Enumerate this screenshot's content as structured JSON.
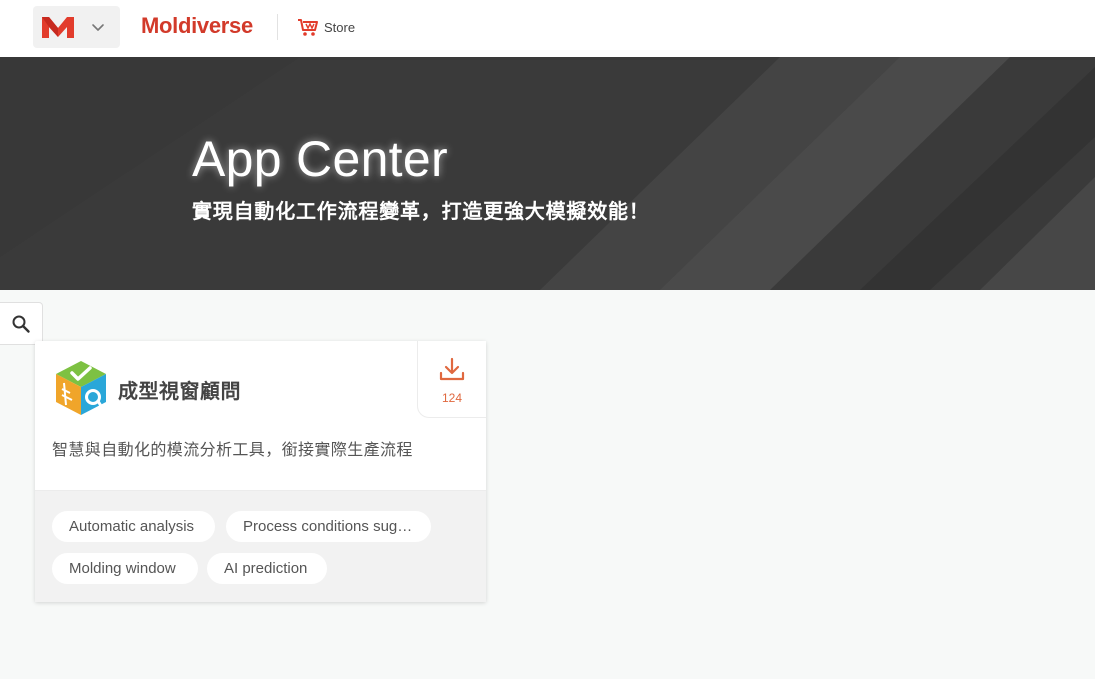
{
  "header": {
    "brand": "Moldiverse",
    "store_label": "Store",
    "accent_color": "#d23a2a"
  },
  "hero": {
    "title": "App Center",
    "subtitle": "實現自動化工作流程變革，打造更強大模擬效能！"
  },
  "apps": [
    {
      "name": "成型視窗顧問",
      "description": "智慧與自動化的模流分析工具，銜接實際生產流程",
      "downloads": "124",
      "tags": [
        "Automatic analysis",
        "Process conditions sug…",
        "Molding window",
        "AI prediction"
      ]
    }
  ],
  "icons": {
    "app_switcher": "m-logo-icon",
    "chevron": "chevron-down-icon",
    "store": "store-cart-icon",
    "search": "search-icon",
    "download": "download-icon"
  }
}
